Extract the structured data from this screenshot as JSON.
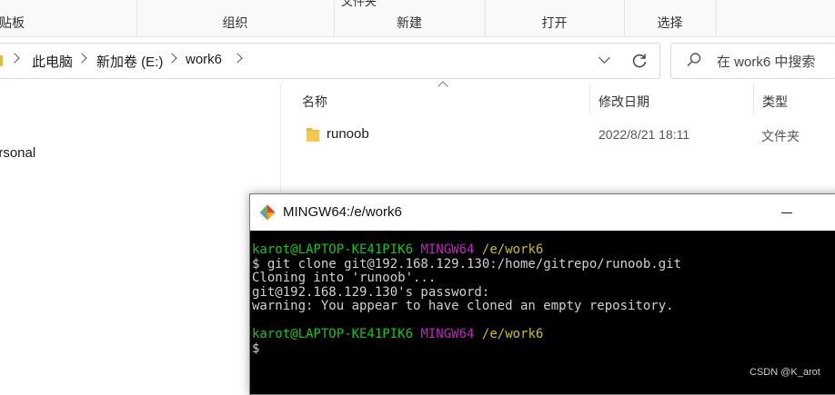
{
  "ribbon": {
    "clipboard_label": "贴板",
    "organize_label": "组织",
    "new_top_label": "文件夹",
    "new_label": "新建",
    "open_top_label": "打开",
    "open_label": "打开",
    "select_label": "选择"
  },
  "address": {
    "crumbs": [
      "此电脑",
      "新加卷 (E:)",
      "work6"
    ],
    "search_placeholder": "在 work6 中搜索"
  },
  "nav_pane": {
    "item_label": "ersonal"
  },
  "file_list": {
    "headers": {
      "name": "名称",
      "modified": "修改日期",
      "type": "类型"
    },
    "rows": [
      {
        "name": "runoob",
        "modified": "2022/8/21 18:11",
        "type": "文件夹"
      }
    ]
  },
  "terminal": {
    "title": "MINGW64:/e/work6",
    "minimize_label": "—",
    "lines": [
      {
        "user": "karot@LAPTOP-KE41PIK6",
        "env": "MINGW64",
        "path": "/e/work6"
      },
      {
        "text": "$ git clone git@192.168.129.130:/home/gitrepo/runoob.git"
      },
      {
        "text": "Cloning into 'runoob'..."
      },
      {
        "text": "git@192.168.129.130's password:"
      },
      {
        "text": "warning: You appear to have cloned an empty repository."
      },
      {
        "text": ""
      },
      {
        "user": "karot@LAPTOP-KE41PIK6",
        "env": "MINGW64",
        "path": "/e/work6"
      },
      {
        "text": "$"
      }
    ]
  },
  "watermark": "CSDN @K_arot",
  "colors": {
    "folder": "#e8b93b",
    "term_green": "#12c41f",
    "term_magenta": "#c026c0",
    "term_yellow": "#c9c018"
  },
  "icons": {
    "folder": "folder-icon",
    "search": "search-icon",
    "refresh": "refresh-icon",
    "git": "git-icon"
  }
}
